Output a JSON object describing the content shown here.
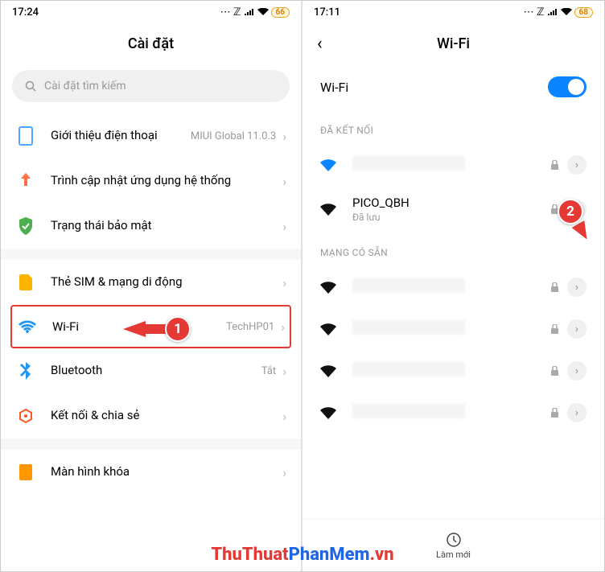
{
  "left": {
    "time": "17:24",
    "battery": "66",
    "title": "Cài đặt",
    "search_placeholder": "Cài đặt tìm kiếm",
    "items": {
      "about": {
        "label": "Giới thiệu điện thoại",
        "value": "MIUI Global 11.0.3"
      },
      "update": {
        "label": "Trình cập nhật ứng dụng hệ thống"
      },
      "security": {
        "label": "Trạng thái bảo mật"
      },
      "sim": {
        "label": "Thẻ SIM & mạng di động"
      },
      "wifi": {
        "label": "Wi-Fi",
        "value": "TechHP01"
      },
      "bluetooth": {
        "label": "Bluetooth",
        "value": "Tắt"
      },
      "connect": {
        "label": "Kết nối & chia sẻ"
      },
      "lock": {
        "label": "Màn hình khóa"
      }
    }
  },
  "right": {
    "time": "17:11",
    "battery": "68",
    "title": "Wi-Fi",
    "toggle_label": "Wi-Fi",
    "section_connected": "ĐÃ KẾT NỐI",
    "section_available": "MẠNG CÓ SẴN",
    "saved": {
      "name": "PICO_QBH",
      "sub": "Đã lưu"
    },
    "refresh": "Làm mới"
  },
  "callouts": {
    "one": "1",
    "two": "2"
  },
  "watermark": {
    "p1": "ThuThuat",
    "p2": "PhanMem",
    "p3": ".vn"
  }
}
